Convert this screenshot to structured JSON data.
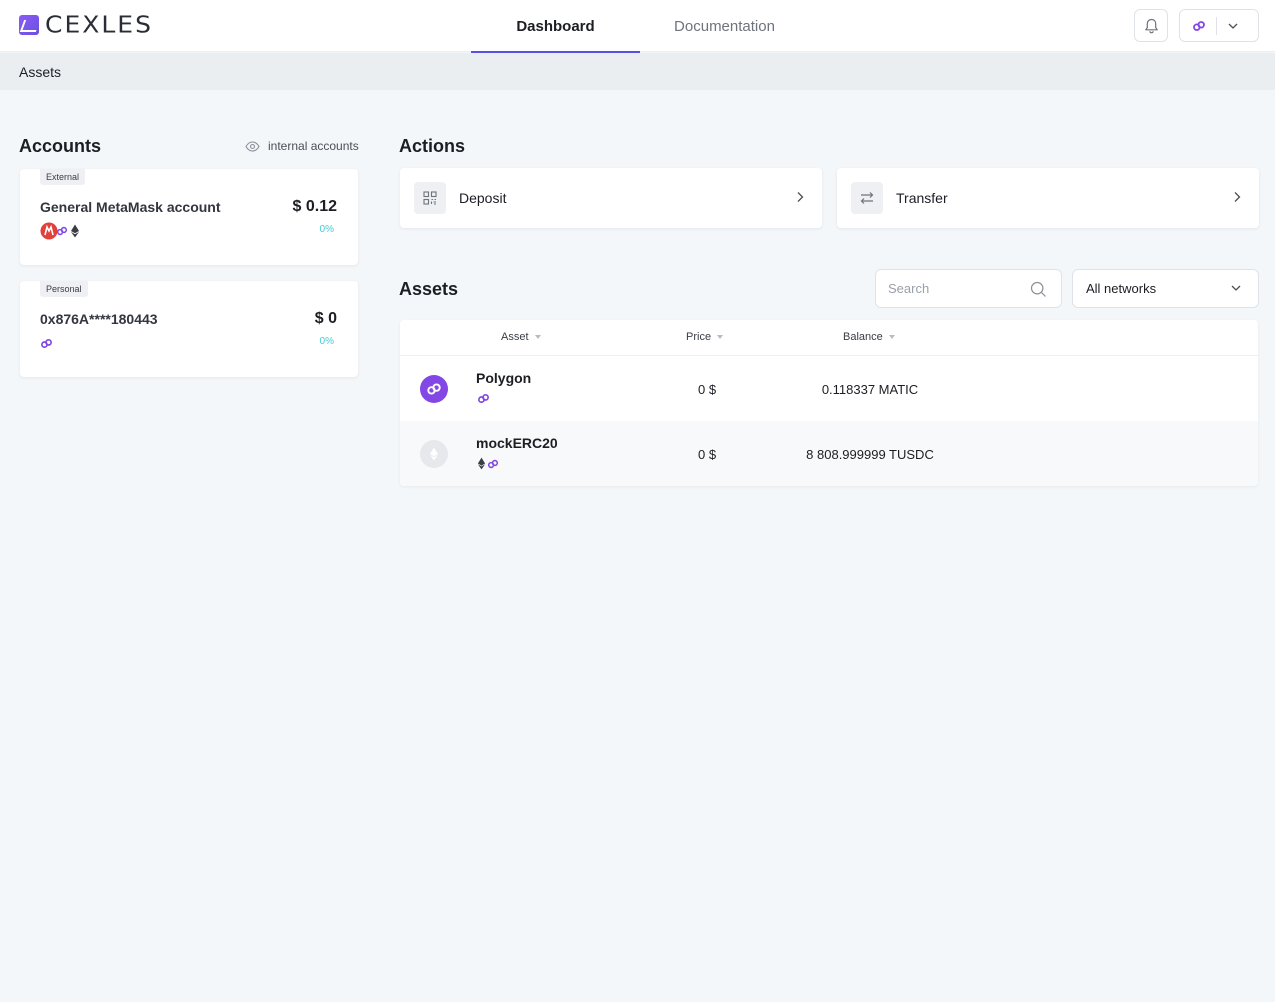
{
  "app": {
    "logo_text": "CEXLES"
  },
  "nav": {
    "tabs": [
      {
        "label": "Dashboard",
        "active": true
      },
      {
        "label": "Documentation",
        "active": false
      }
    ]
  },
  "header": {
    "bell_icon": "bell-icon",
    "network_icon": "polygon-icon"
  },
  "breadcrumb": {
    "current": "Assets"
  },
  "accounts": {
    "title": "Accounts",
    "toggle_label": "internal accounts",
    "items": [
      {
        "tag": "External",
        "name": "General MetaMask account",
        "value": "$ 0.12",
        "change": "0%",
        "network_icons": [
          "metamask-icon",
          "polygon-icon",
          "ethereum-icon"
        ]
      },
      {
        "tag": "Personal",
        "name": "0x876A****180443",
        "value": "$ 0",
        "change": "0%",
        "network_icons": [
          "polygon-icon"
        ]
      }
    ]
  },
  "actions": {
    "title": "Actions",
    "items": [
      {
        "label": "Deposit",
        "icon": "qr-code-icon"
      },
      {
        "label": "Transfer",
        "icon": "arrows-swap-icon"
      }
    ]
  },
  "assets": {
    "title": "Assets",
    "search_placeholder": "Search",
    "network_filter": "All networks",
    "columns": [
      "Asset",
      "Price",
      "Balance"
    ],
    "rows": [
      {
        "name": "Polygon",
        "price": "0 $",
        "balance": "0.118337 MATIC",
        "logo": "polygon-logo-icon",
        "networks": [
          "polygon-icon"
        ]
      },
      {
        "name": "mockERC20",
        "price": "0 $",
        "balance": "8 808.999999 TUSDC",
        "logo": "ethereum-logo-icon",
        "networks": [
          "ethereum-icon",
          "polygon-icon"
        ]
      }
    ]
  },
  "colors": {
    "accent": "#5b4de8",
    "polygon": "#8247e5",
    "positive": "#3ecfd4",
    "background": "#f4f7f9"
  }
}
